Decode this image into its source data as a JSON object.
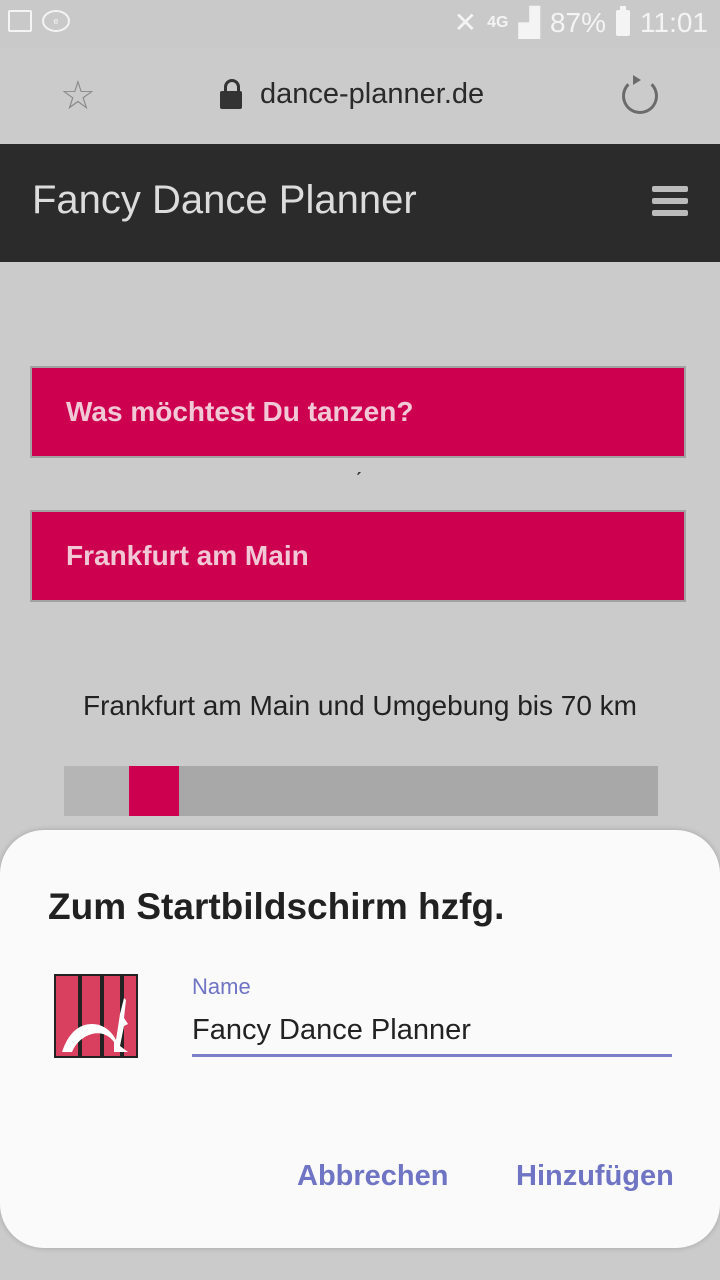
{
  "status_bar": {
    "battery": "87%",
    "time": "11:01",
    "network": "4G",
    "icons": [
      "image-icon",
      "ebay-icon",
      "mute-icon",
      "signal-icon",
      "battery-icon"
    ]
  },
  "browser": {
    "url": "dance-planner.de",
    "icons": [
      "star-icon",
      "lock-icon",
      "reload-icon"
    ]
  },
  "app": {
    "title": "Fancy Dance Planner"
  },
  "search": {
    "dance_field": "Was möchtest Du tanzen?",
    "location_field": "Frankfurt am Main",
    "radius_text": "Frankfurt am Main und Umgebung bis 70 km",
    "radius_level_fraction": 0.12
  },
  "dialog": {
    "title": "Zum Startbildschirm hzfg.",
    "name_label": "Name",
    "name_value": "Fancy Dance Planner",
    "cancel_label": "Abbrechen",
    "add_label": "Hinzufügen"
  },
  "colors": {
    "accent": "#cd0050",
    "dialog_accent": "#6f74c4",
    "appbar": "#2b2b2b"
  }
}
